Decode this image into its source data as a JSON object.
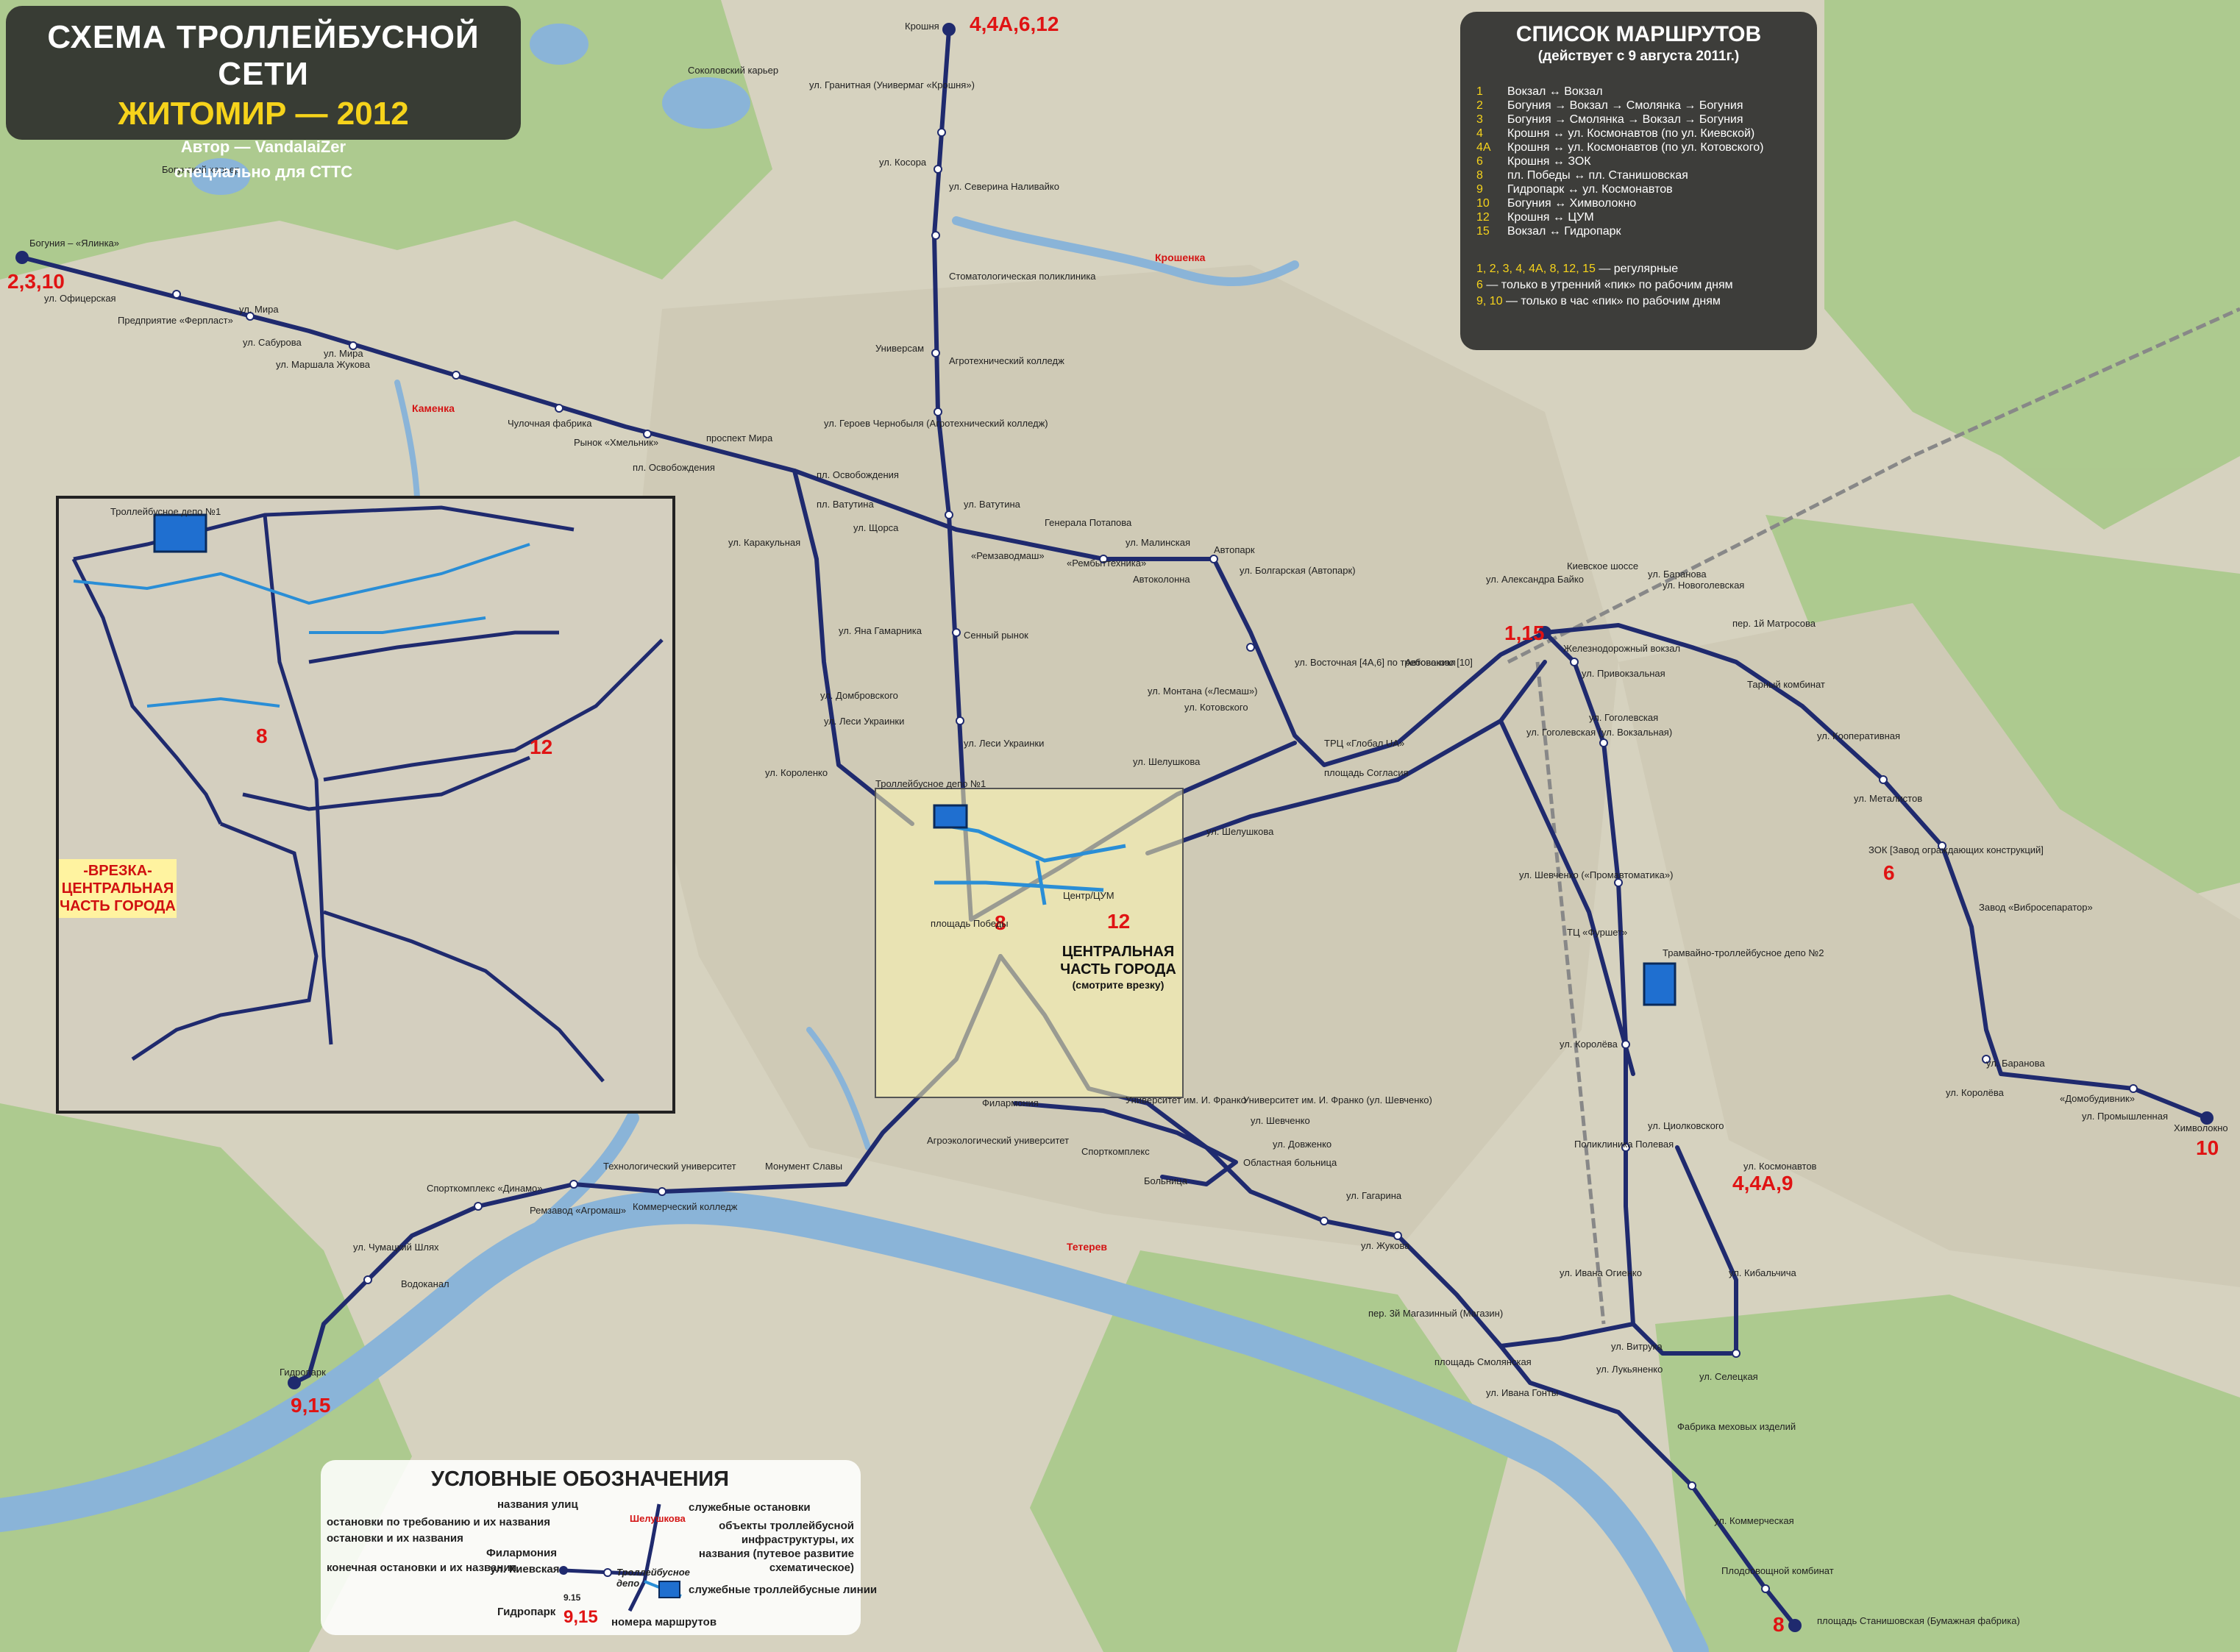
{
  "title": {
    "line1": "СХЕМА ТРОЛЛЕЙБУСНОЙ СЕТИ",
    "line2": "ЖИТОМИР — 2012",
    "line3": "Автор — VandalaiZer",
    "line4": "специально для СТТС"
  },
  "routes_list": {
    "heading": "СПИСОК МАРШРУТОВ",
    "subheading": "(действует с 9 августа 2011г.)",
    "items": [
      {
        "num": "1",
        "desc": "Вокзал ↔ Вокзал"
      },
      {
        "num": "2",
        "desc": "Богуния → Вокзал → Смолянка → Богуния"
      },
      {
        "num": "3",
        "desc": "Богуния → Смолянка → Вокзал → Богуния"
      },
      {
        "num": "4",
        "desc": "Крошня ↔ ул. Космонавтов (по ул. Киевской)"
      },
      {
        "num": "4А",
        "desc": "Крошня ↔ ул. Космонавтов (по ул. Котовского)"
      },
      {
        "num": "6",
        "desc": "Крошня ↔ ЗОК"
      },
      {
        "num": "8",
        "desc": "пл. Победы ↔ пл. Станишовская"
      },
      {
        "num": "9",
        "desc": "Гидропарк ↔ ул. Космонавтов"
      },
      {
        "num": "10",
        "desc": "Богуния ↔ Химволокно"
      },
      {
        "num": "12",
        "desc": "Крошня ↔ ЦУМ"
      },
      {
        "num": "15",
        "desc": "Вокзал ↔ Гидропарк"
      }
    ],
    "note_regular_nums": "1, 2, 3, 4, 4А, 8, 12, 15",
    "note_regular_text": " — регулярные",
    "note_6_num": "6",
    "note_6_text": " — только в утренний «пик» по рабочим дням",
    "note_910_num": "9, 10",
    "note_910_text": " — только в час «пик» по рабочим дням"
  },
  "legend": {
    "heading": "УСЛОВНЫЕ ОБОЗНАЧЕНИЯ",
    "street_names": "названия улиц",
    "request_stops": "остановки по требованию и их названия",
    "stops": "остановки и их названия",
    "terminal_stops": "конечная остановки и их названия",
    "service_stops": "служебные остановки",
    "infrastructure": "объекты троллейбусной инфраструктуры, их названия (путевое развитие схематическое)",
    "service_lines": "служебные троллейбусные линии",
    "route_numbers": "номера маршрутов",
    "sample_street": "Шелушкова",
    "sample_stop1": "Филармония",
    "sample_stop2": "ул. Киевская",
    "sample_terminal": "Гидропарк",
    "sample_depot": "Троллейбусное депо",
    "sample_routes": "9,15",
    "sample_service": "9.15"
  },
  "inset": {
    "label_line1": "-ВРЕЗКА-",
    "label_line2": "ЦЕНТРАЛЬНАЯ",
    "label_line3": "ЧАСТЬ ГОРОДА",
    "depot": "Троллейбусное депо №1"
  },
  "central_area": {
    "line1": "ЦЕНТРАЛЬНАЯ",
    "line2": "ЧАСТЬ ГОРОДА",
    "line3": "(смотрите врезку)"
  },
  "map_labels": {
    "kroshnya": "Крошня",
    "granitnaya": "ул. Гранитная (Универмаг «Крошня»)",
    "kosmoskarer": "Соколовский карьер",
    "bogunskiy_karer": "Богунский карьер",
    "kosora": "ул. Косора",
    "severina": "ул. Северина Наливайко",
    "stomat": "Стоматологическая поликлиника",
    "universam": "Универсам",
    "agrotech": "Агротехнический колледж",
    "geroev": "ул. Героев Чернобыля (Агротехнический колледж)",
    "osvob1": "пл. Освобождения",
    "osvob2": "пл. Освобождения",
    "vatutina": "пл. Ватутина",
    "vatutina2": "ул. Ватутина",
    "general": "Генерала Потапова",
    "remzavod": "«Ремзаводмаш»",
    "rembyt": "«Рембыттехника»",
    "karakulnaya": "ул. Каракульная",
    "shchorsa": "ул. Щорса",
    "malinskaya": "ул. Малинская",
    "avtopark": "Автопарк",
    "bolgarskaya": "ул. Болгарская (Автопарк)",
    "avtokolonna": "Автоколонна",
    "gamarnik": "ул. Яна Гамарника",
    "sennoy": "Сенный рынок",
    "dombrovskogo": "ул. Домбровского",
    "lesi1": "ул. Леси Украинки",
    "lesi2": "ул. Леси Украинки",
    "montana": "ул. Монтана («Лесмаш»)",
    "vostochnaya": "ул. Восточная [4А,6] по требованию [10]",
    "kotovskogo": "ул. Котовского",
    "shelushkova1": "ул. Шелушкова",
    "shelushkova2": "ул. Шелушкова",
    "korolenko": "ул. Короленко",
    "depot1": "Троллейбусное депо №1",
    "pobedy": "площадь Победы",
    "center": "Центр/ЦУМ",
    "soglasiya": "площадь Согласия",
    "globa": "ТРЦ «Глобал UA»",
    "avtovokzal": "Автовокзал",
    "vokzal": "Железнодорожный вокзал",
    "privokzalnaya": "ул. Привокзальная",
    "kievskoe": "Киевское шоссе",
    "bayko": "ул. Александра Байко",
    "baranova1": "ул. Баранова",
    "novogolevskaya": "ул. Новоголевская",
    "matrosova": "пер. 1й Матросова",
    "tarnyy": "Тарный комбинат",
    "gogolevskaya1": "ул. Гоголевская",
    "gogolevskaya2": "ул. Гоголевская (ул. Вокзальная)",
    "kooperativnaya": "ул. Кооперативная",
    "metallistov": "ул. Металистов",
    "zok": "ЗОК [Завод ограждающих конструкций]",
    "vibro": "Завод «Вибросепаратор»",
    "shevchenko1": "ул. Шевченко («Промавтоматика»)",
    "furshet": "ТЦ «Фуршет»",
    "depot2": "Трамвайно-троллейбусное депо №2",
    "koroleva1": "ул. Королёва",
    "baranova2": "ул. Баранова",
    "koroleva2": "ул. Королёва",
    "domobud": "«Домобудивник»",
    "promyshlennaya": "ул. Промышленная",
    "khimvolokno": "Химволокно",
    "tsiolkovskogo": "ул. Циолковского",
    "polevaya": "Поликлиника Полевая",
    "kosmonavtov": "ул. Космонавтов",
    "kibalchicha": "ул. Кибальчича",
    "ivana_ogienko": "ул. Ивана Огиенко",
    "vitruka": "ул. Витрука",
    "selekskaya": "ул. Селецкая",
    "lukyanenko": "ул. Лукьяненко",
    "smolyanskaya": "площадь Смолянская",
    "ivana_gonty": "ул. Ивана Гонты",
    "fabrika": "Фабрика меховых изделий",
    "kommercheskaya": "ул. Коммерческая",
    "plodoovoshch": "Плодоовощной комбинат",
    "stanishovskaya": "площадь Станишовская (Бумажная фабрика)",
    "zhukova": "ул. Жукова",
    "gagarina": "ул. Гагарина",
    "magazinnyy": "пер. 3й Магазинный (Магазин)",
    "franko1": "Университет им. И. Франко",
    "franko2": "Университет им. И. Франко (ул. Шевченко)",
    "shevchenko2": "ул. Шевченко",
    "dovzhenko": "ул. Довженко",
    "oblastnaya": "Областная больница",
    "bolnitsa": "Больница",
    "sportkompleks": "Спорткомплекс",
    "agroekolog": "Агроэкологический университет",
    "filarmoniya": "Филармония",
    "monument": "Монумент Славы",
    "kommerch_kolledzh": "Коммерческий колледж",
    "tekhnolog": "Технологический университет",
    "remzavod2": "Ремзавод «Агромаш»",
    "sportkompleks_dinamo": "Спорткомплекс «Динамо»",
    "chumatskiy": "ул. Чумацкий Шлях",
    "vodokanal": "Водоканал",
    "gidropark": "Гидропарк",
    "bogunia": "Богуния – «Ялинка»",
    "ofitserskaya": "ул. Офицерская",
    "ferplast": "Предприятие «Ферпласт»",
    "mira1": "ул. Мира",
    "mira2": "ул. Мира",
    "saburova": "ул. Сабурова",
    "zhukova_m": "ул. Маршала Жукова",
    "chulochnaya": "Чулочная фабрика",
    "rynok": "Рынок «Хмельник»",
    "prospekt_mira": "проспект Мира",
    "kamenka": "Каменка",
    "teterev": "Тетерев",
    "kroshenka": "Крошенка"
  },
  "route_badges": {
    "kroshnya": "4,4А,6,12",
    "bogunia": "2,3,10",
    "vokzal": "1,15",
    "zok": "6",
    "khimvolokno": "10",
    "kosmonavtov": "4,4А,9",
    "gidropark": "9,15",
    "stanishovskaya": "8",
    "center": "12",
    "pobedy": "8",
    "inset_pobedy": "8",
    "inset_center": "12"
  },
  "colors": {
    "route_line": "#1f2a6e",
    "service_line": "#2a8ed6",
    "badge_red": "#e01313",
    "accent_yellow": "#f6d31b",
    "water": "#8ab4d8",
    "forest": "#a9c98a"
  }
}
